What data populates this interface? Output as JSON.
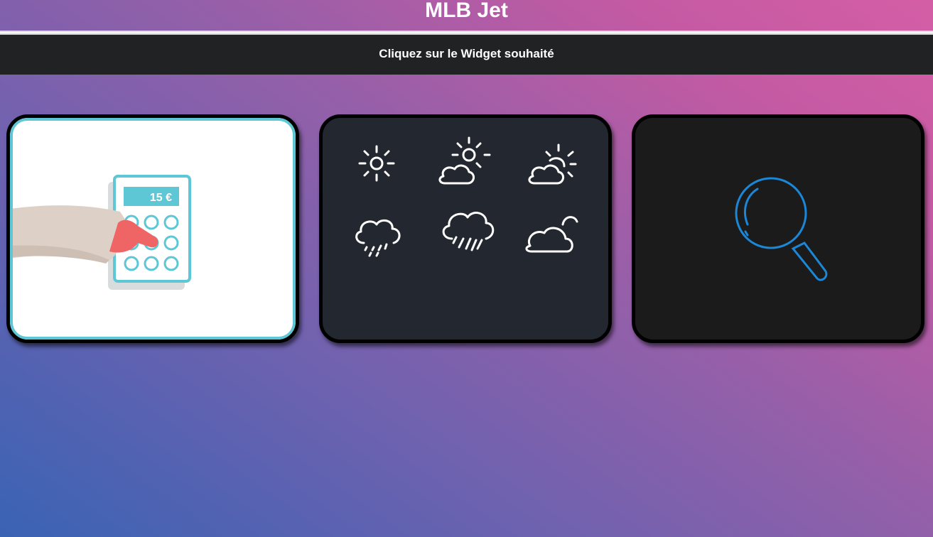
{
  "header": {
    "title": "MLB Jet"
  },
  "subheader": {
    "text": "Cliquez sur le Widget souhaité"
  },
  "widgets": [
    {
      "name": "calculator",
      "display_value": "15 €"
    },
    {
      "name": "weather"
    },
    {
      "name": "search"
    }
  ],
  "colors": {
    "calc_accent": "#5ec7d6",
    "finger": "#ef6464",
    "search_blue": "#1b87d6",
    "weather_bg": "#23272f",
    "search_bg": "#1b1b1b"
  }
}
